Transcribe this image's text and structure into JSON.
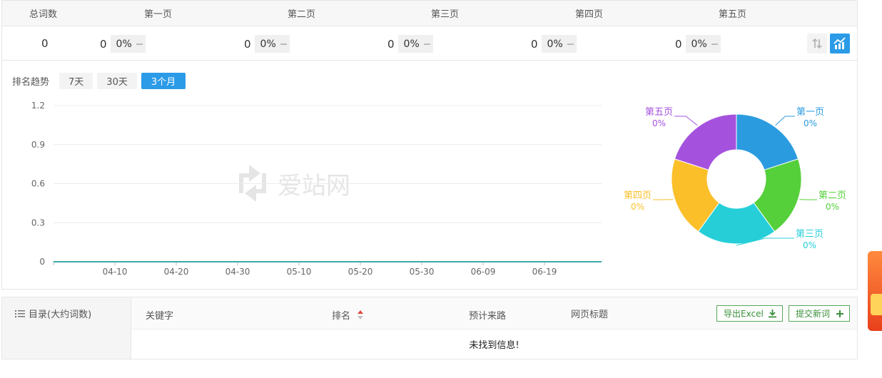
{
  "summary": {
    "headers": [
      "总词数",
      "第一页",
      "第二页",
      "第三页",
      "第四页",
      "第五页"
    ],
    "total": "0",
    "pages": [
      {
        "count": "0",
        "pct": "0%"
      },
      {
        "count": "0",
        "pct": "0%"
      },
      {
        "count": "0",
        "pct": "0%"
      },
      {
        "count": "0",
        "pct": "0%"
      },
      {
        "count": "0",
        "pct": "0%"
      }
    ]
  },
  "trend": {
    "label": "排名趋势",
    "ranges": [
      "7天",
      "30天",
      "3个月"
    ],
    "active_range": "3个月"
  },
  "watermark": "爱站网",
  "chart_data": [
    {
      "type": "line",
      "x": [
        "04-10",
        "04-20",
        "04-30",
        "05-10",
        "05-20",
        "05-30",
        "06-09",
        "06-19"
      ],
      "yticks": [
        "0",
        "0.3",
        "0.6",
        "0.9",
        "1.2"
      ],
      "ylim": [
        0,
        1.2
      ],
      "series": [
        {
          "values": [
            0,
            0,
            0,
            0,
            0,
            0,
            0,
            0
          ]
        }
      ],
      "grid": true,
      "colors": [
        "#3fa7a9"
      ]
    },
    {
      "type": "pie",
      "labels": [
        "第一页",
        "第二页",
        "第三页",
        "第四页",
        "第五页"
      ],
      "values": [
        0,
        0,
        0,
        0,
        0
      ],
      "display": [
        "0%",
        "0%",
        "0%",
        "0%",
        "0%"
      ],
      "colors": [
        "#2b9be0",
        "#55cf3a",
        "#26cfd8",
        "#fbbf2a",
        "#a452de"
      ]
    }
  ],
  "bottom": {
    "side_label": "目录(大约词数)",
    "columns": [
      "关键字",
      "排名",
      "预计来路",
      "网页标题"
    ],
    "export_label": "导出Excel",
    "submit_label": "提交新词",
    "empty_message": "未找到信息!"
  },
  "colors": {
    "accent": "#2b9be8",
    "green": "#3a8f3a"
  }
}
